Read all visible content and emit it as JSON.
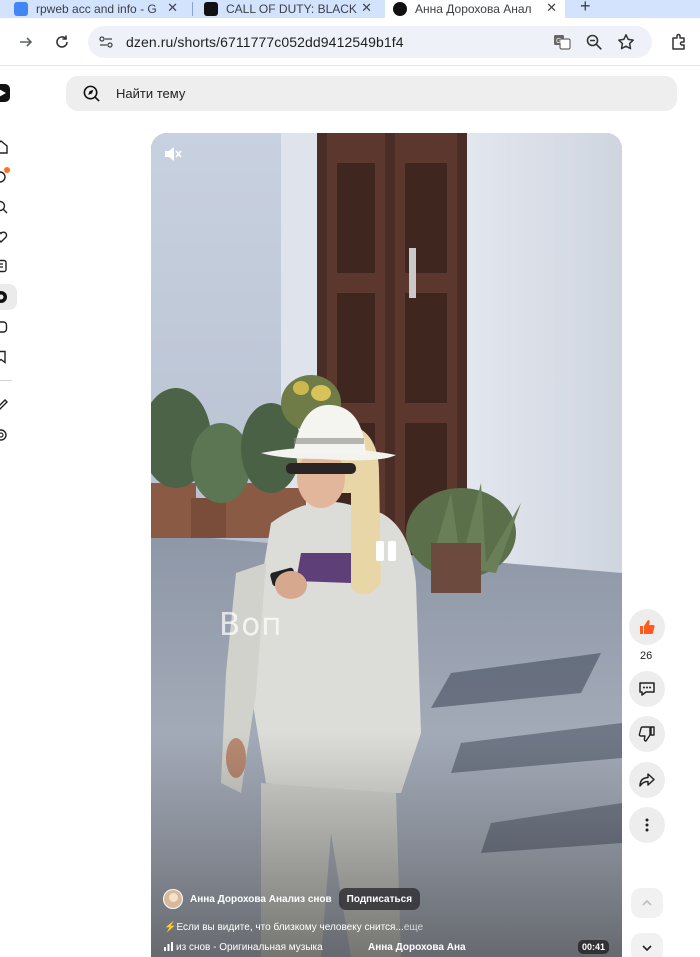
{
  "browser": {
    "tabs": [
      {
        "title": "rpweb acc and info - G",
        "active": false
      },
      {
        "title": "CALL OF DUTY: BLACK",
        "active": false
      },
      {
        "title": "Анна Дорохова Анал",
        "active": true
      }
    ],
    "url": "dzen.ru/shorts/6711777c052dd9412549b1f4"
  },
  "header": {
    "search_placeholder": "Найти тему"
  },
  "video": {
    "overlay_text": "Воп",
    "author": "Анна Дорохова Анализ снов",
    "subscribe_label": "Подписаться",
    "description": "Если вы видите, что близкому человеку снится...",
    "more_label": "еще",
    "music": "из снов - Оригинальная музыка",
    "music_author": "Анна Дорохова Ана",
    "duration": "00:41"
  },
  "actions": {
    "like_count": "26"
  },
  "colors": {
    "accent": "#ff5a1f",
    "tab_bg": "#d3e3fd",
    "omnibox": "#eef2f8"
  }
}
